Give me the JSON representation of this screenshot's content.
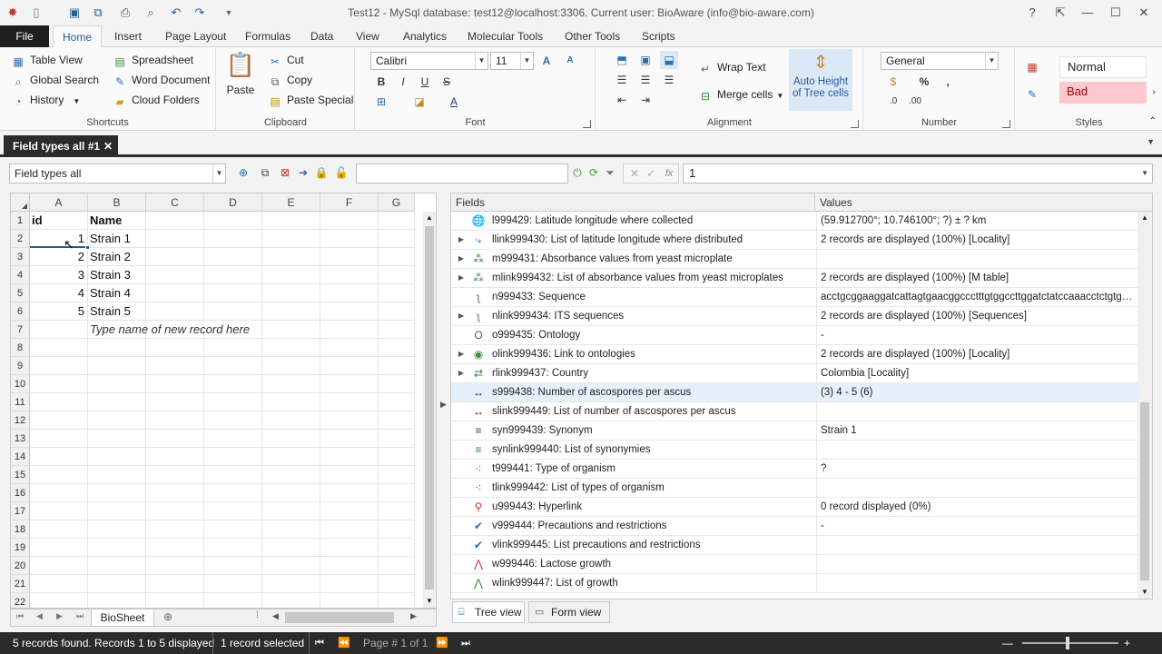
{
  "window": {
    "title": "Test12 - MySql database: test12@localhost:3306. Current user: BioAware (info@bio-aware.com)"
  },
  "ribbon_tabs": [
    "File",
    "Home",
    "Insert",
    "Page Layout",
    "Formulas",
    "Data",
    "View",
    "Analytics",
    "Molecular Tools",
    "Other Tools",
    "Scripts"
  ],
  "active_ribbon_tab": "Home",
  "shortcuts": {
    "table_view": "Table View",
    "global_search": "Global Search",
    "history": "History",
    "spreadsheet": "Spreadsheet",
    "word_document": "Word Document",
    "cloud_folders": "Cloud Folders",
    "label": "Shortcuts"
  },
  "clipboard": {
    "paste": "Paste",
    "cut": "Cut",
    "copy": "Copy",
    "paste_special": "Paste Special",
    "label": "Clipboard"
  },
  "font": {
    "name": "Calibri",
    "size": "11",
    "label": "Font"
  },
  "alignment": {
    "wrap_text": "Wrap Text",
    "merge_cells": "Merge cells",
    "auto_height": "Auto Height of Tree cells",
    "label": "Alignment"
  },
  "number": {
    "format": "General",
    "label": "Number"
  },
  "styles": {
    "normal": "Normal",
    "bad": "Bad",
    "label": "Styles"
  },
  "document_tab": "Field types all #1",
  "toolbar": {
    "view_selector": "Field types all",
    "formula_value": "1"
  },
  "grid": {
    "columns": [
      "A",
      "B",
      "C",
      "D",
      "E",
      "F",
      "G"
    ],
    "row_numbers": [
      "1",
      "2",
      "3",
      "4",
      "5",
      "6",
      "7",
      "8",
      "9",
      "10",
      "11",
      "12",
      "13",
      "14",
      "15",
      "16",
      "17",
      "18",
      "19",
      "20",
      "21",
      "22"
    ],
    "header": [
      "id",
      "Name"
    ],
    "rows": [
      {
        "id": "1",
        "name": "Strain 1"
      },
      {
        "id": "2",
        "name": "Strain 2"
      },
      {
        "id": "3",
        "name": "Strain 3"
      },
      {
        "id": "4",
        "name": "Strain 4"
      },
      {
        "id": "5",
        "name": "Strain 5"
      }
    ],
    "new_record_hint": "Type name of new record here"
  },
  "sheet_tab": "BioSheet",
  "fields_panel": {
    "col_fields": "Fields",
    "col_values": "Values",
    "rows": [
      {
        "name": "l999429: Latitude longitude where collected",
        "value": "(59.912700°; 10.746100°; ?) ± ? km",
        "icon": "globe-icon",
        "glyph": "🌐",
        "color": "#2a6fb0",
        "expand": false
      },
      {
        "name": "llink999430: List of latitude longitude where distributed",
        "value": "2 records are displayed (100%) [Locality]",
        "icon": "globe-link-icon",
        "glyph": "⤷",
        "color": "#2a6fb0",
        "expand": true
      },
      {
        "name": "m999431: Absorbance values from yeast microplate",
        "value": "",
        "icon": "microplate-icon",
        "glyph": "⁂",
        "color": "#3a8a3a",
        "expand": true
      },
      {
        "name": "mlink999432: List of absorbance values from yeast microplates",
        "value": "2 records are displayed (100%) [M table]",
        "icon": "microplate-link-icon",
        "glyph": "⁂",
        "color": "#3a8a3a",
        "expand": true
      },
      {
        "name": "n999433: Sequence",
        "value": "acctgcggaaggatcattagtgaacggccctttgtggccttggatctatccaaacctctgtg…",
        "icon": "sequence-icon",
        "glyph": "ʅ",
        "color": "#666666",
        "expand": false
      },
      {
        "name": "nlink999434: ITS sequences",
        "value": "2 records are displayed (100%) [Sequences]",
        "icon": "sequence-link-icon",
        "glyph": "ʅ",
        "color": "#3a8a3a",
        "expand": true
      },
      {
        "name": "o999435: Ontology",
        "value": "-",
        "icon": "ontology-icon",
        "glyph": "O",
        "color": "#555555",
        "expand": false
      },
      {
        "name": "olink999436: Link to ontologies",
        "value": "2 records are displayed (100%) [Locality]",
        "icon": "ontology-link-icon",
        "glyph": "◉",
        "color": "#3a8a3a",
        "expand": true
      },
      {
        "name": "rlink999437: Country",
        "value": "Colombia [Locality]",
        "icon": "country-icon",
        "glyph": "⇄",
        "color": "#3a8a3a",
        "expand": true
      },
      {
        "name": "s999438: Number of ascospores per ascus",
        "value": "(3) 4 - 5 (6)",
        "icon": "range-icon",
        "glyph": "↔",
        "color": "#222222",
        "expand": false,
        "selected": true
      },
      {
        "name": "slink999449: List of number of ascospores per ascus",
        "value": "",
        "icon": "range-link-icon",
        "glyph": "↔",
        "color": "#222222",
        "expand": false
      },
      {
        "name": "syn999439: Synonym",
        "value": "Strain 1",
        "icon": "synonym-icon",
        "glyph": "≡",
        "color": "#444444",
        "expand": false
      },
      {
        "name": "synlink999440: List of synonymies",
        "value": "",
        "icon": "synonym-link-icon",
        "glyph": "≡",
        "color": "#3a8a3a",
        "expand": false
      },
      {
        "name": "t999441: Type of organism",
        "value": "?",
        "icon": "organism-icon",
        "glyph": "⁖",
        "color": "#c0392b",
        "expand": false
      },
      {
        "name": "tlink999442: List of types of organism",
        "value": "",
        "icon": "organism-link-icon",
        "glyph": "⁖",
        "color": "#c0392b",
        "expand": false
      },
      {
        "name": "u999443: Hyperlink",
        "value": "0 record displayed (0%)",
        "icon": "hyperlink-icon",
        "glyph": "⚲",
        "color": "#c0392b",
        "expand": false
      },
      {
        "name": "v999444: Precautions and restrictions",
        "value": "-",
        "icon": "check-icon",
        "glyph": "✔",
        "color": "#2a6fb0",
        "expand": false
      },
      {
        "name": "vlink999445: List precautions and restrictions",
        "value": "",
        "icon": "check-link-icon",
        "glyph": "✔",
        "color": "#2a6fb0",
        "expand": false
      },
      {
        "name": "w999446: Lactose growth",
        "value": "",
        "icon": "growth-curve-icon",
        "glyph": "⋀",
        "color": "#c0392b",
        "expand": false
      },
      {
        "name": "wlink999447: List of growth",
        "value": "",
        "icon": "growth-link-icon",
        "glyph": "⋀",
        "color": "#3a8a3a",
        "expand": false
      }
    ]
  },
  "view_tabs": {
    "tree": "Tree view",
    "form": "Form view"
  },
  "status": {
    "records_found": "5 records found. Records 1 to 5 displayed",
    "selected": "1 record selected",
    "page": "Page # 1 of 1"
  },
  "colors": {
    "accent": "#2b579a",
    "dark_bar": "#2b2b2b",
    "bad_bg": "#ffc7ce",
    "bad_text": "#9c0006",
    "selected_row": "#e5f0fb"
  }
}
